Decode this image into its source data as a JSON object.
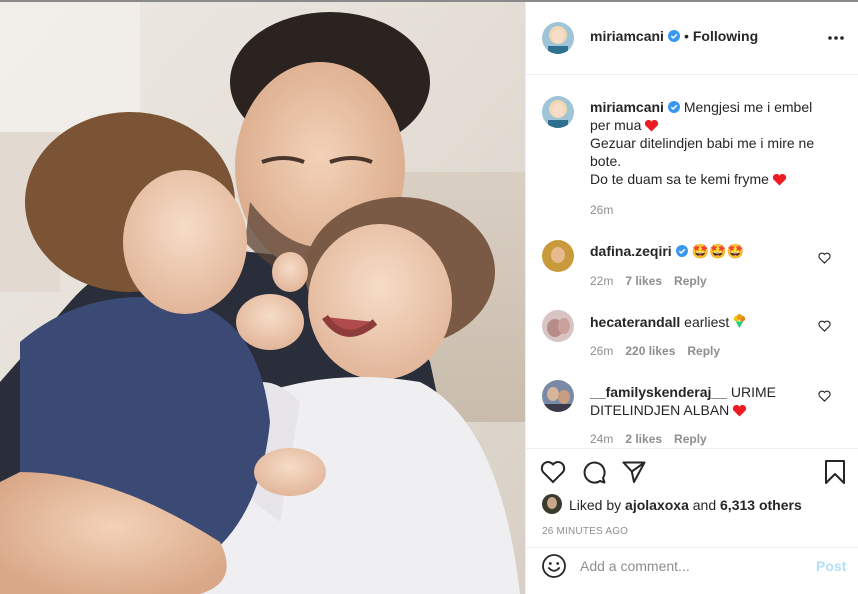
{
  "post": {
    "author": "miriamcani",
    "following_label": "Following",
    "caption_lines": [
      "Mengjesi me i embel",
      "per mua",
      "Gezuar ditelindjen babi me i mire ne",
      "bote.",
      "Do te duam sa te kemi fryme"
    ],
    "caption_time": "26m"
  },
  "comments": [
    {
      "username": "dafina.zeqiri",
      "text": "🤩🤩🤩",
      "time": "22m",
      "likes": "7 likes",
      "reply": "Reply"
    },
    {
      "username": "hecaterandall",
      "text": "earliest",
      "time": "26m",
      "likes": "220 likes",
      "reply": "Reply"
    },
    {
      "username": "__familyskenderaj__",
      "text": "URIME DITELINDJEN ALBAN",
      "time": "24m",
      "likes": "2 likes",
      "reply": "Reply"
    }
  ],
  "likes": {
    "prefix": "Liked by",
    "user": "ajolaxoxa",
    "joiner": "and",
    "others": "6,313 others"
  },
  "timestamp": "26 MINUTES AGO",
  "add_comment": {
    "placeholder": "Add a comment...",
    "post_label": "Post"
  },
  "colors": {
    "verified_blue": "#3897f0",
    "heart_red": "#ed1c24",
    "post_button_disabled": "#b2dffc",
    "meta_gray": "#8e8e8e"
  },
  "icons": [
    "more-icon",
    "verified-icon",
    "heart-icon",
    "comment-icon",
    "share-icon",
    "bookmark-icon",
    "emoji-icon"
  ]
}
